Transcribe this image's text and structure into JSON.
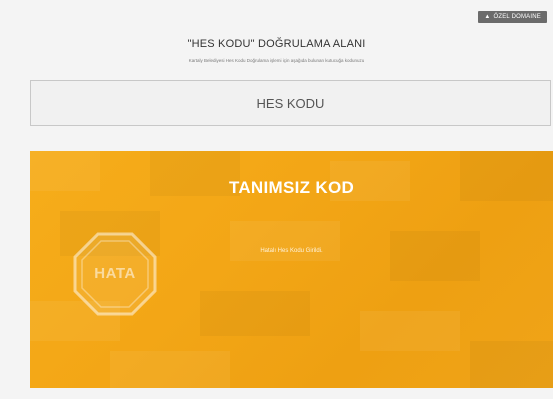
{
  "header": {
    "top_button_label": "ÖZEL DOMAINE",
    "top_button_icon": "user-icon",
    "title": "\"HES KODU\" DOĞRULAMA ALANI",
    "subtitle": "Kartaly Belediyesi Hes Kodu Doğrulama işlemi için aşağıda bulunan kutucuğa kodunuzu"
  },
  "search": {
    "placeholder": "HES KODU",
    "value": ""
  },
  "result": {
    "title": "TANIMSIZ KOD",
    "message": "Hatalı Hes Kodu Girildi.",
    "badge_label": "HATA",
    "badge_icon": "octagon-error-icon",
    "panel_color": "#f4a817"
  },
  "colors": {
    "background": "#f4f4f4",
    "accent": "#f4a817",
    "button_bg": "#6b6b6b"
  }
}
